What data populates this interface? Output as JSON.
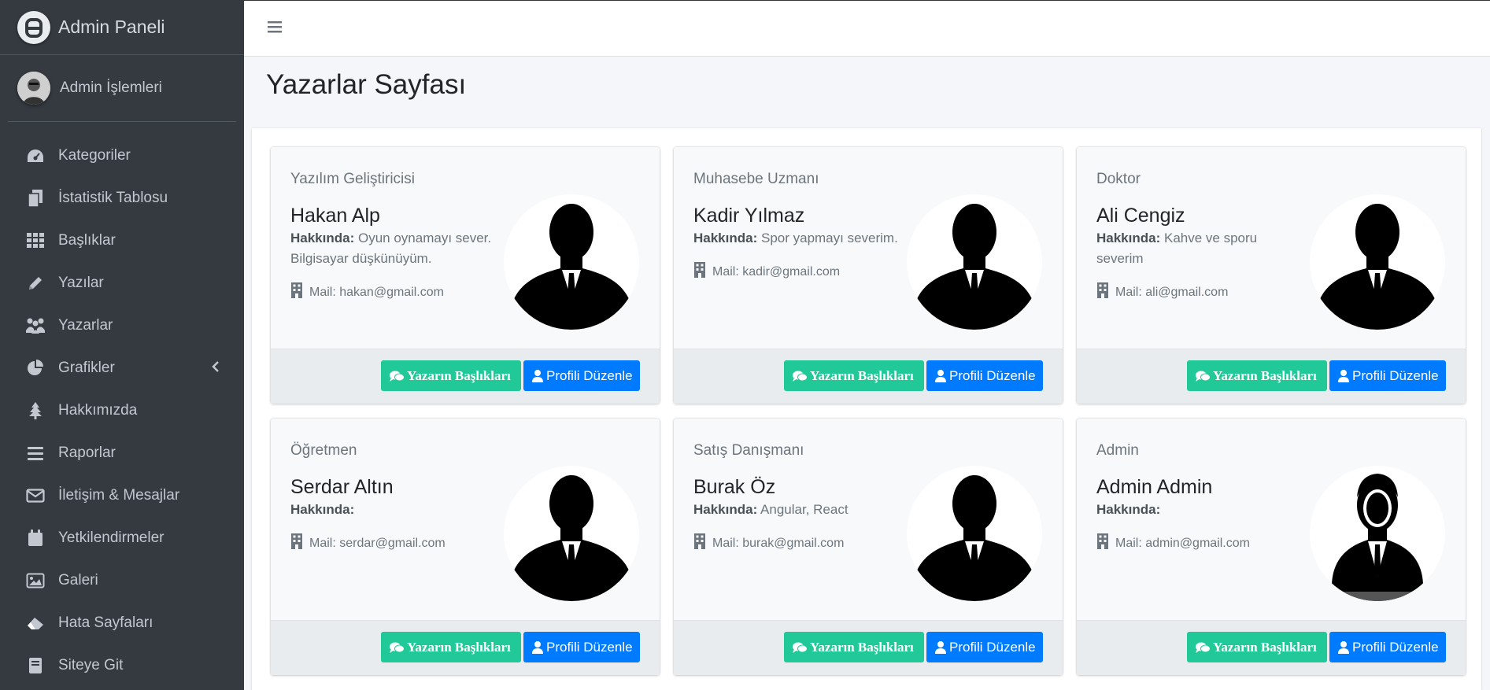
{
  "brand": {
    "title": "Admin Paneli"
  },
  "user": {
    "name": "Admin İşlemleri"
  },
  "sidebar": {
    "items": [
      {
        "label": "Kategoriler",
        "icon": "tachometer-icon"
      },
      {
        "label": "İstatistik Tablosu",
        "icon": "copy-icon"
      },
      {
        "label": "Başlıklar",
        "icon": "grid-icon"
      },
      {
        "label": "Yazılar",
        "icon": "pencil-icon"
      },
      {
        "label": "Yazarlar",
        "icon": "users-icon"
      },
      {
        "label": "Grafikler",
        "icon": "pie-chart-icon"
      },
      {
        "label": "Hakkımızda",
        "icon": "tree-icon"
      },
      {
        "label": "Raporlar",
        "icon": "bars-icon"
      },
      {
        "label": "İletişim & Mesajlar",
        "icon": "envelope-icon"
      },
      {
        "label": "Yetkilendirmeler",
        "icon": "calendar-icon"
      },
      {
        "label": "Galeri",
        "icon": "image-icon"
      },
      {
        "label": "Hata Sayfaları",
        "icon": "eraser-icon"
      },
      {
        "label": "Siteye Git",
        "icon": "book-icon"
      }
    ]
  },
  "page": {
    "title": "Yazarlar Sayfası"
  },
  "labels": {
    "about": "Hakkında:",
    "mail_prefix": "Mail: ",
    "titles_button": "Yazarın Başlıkları",
    "edit_button": "Profili Düzenle"
  },
  "authors": [
    {
      "role": "Yazılım Geliştiricisi",
      "name": "Hakan Alp",
      "about": "Oyun oynamayı sever. Bilgisayar düşkünüyüm.",
      "mail": "hakan@gmail.com"
    },
    {
      "role": "Muhasebe Uzmanı",
      "name": "Kadir Yılmaz",
      "about": "Spor yapmayı severim.",
      "mail": "kadir@gmail.com"
    },
    {
      "role": "Doktor",
      "name": "Ali Cengiz",
      "about": "Kahve ve sporu severim",
      "mail": "ali@gmail.com"
    },
    {
      "role": "Öğretmen",
      "name": "Serdar Altın",
      "about": "",
      "mail": "serdar@gmail.com"
    },
    {
      "role": "Satış Danışmanı",
      "name": "Burak Öz",
      "about": "Angular, React",
      "mail": "burak@gmail.com"
    },
    {
      "role": "Admin",
      "name": "Admin Admin",
      "about": "",
      "mail": "admin@gmail.com"
    }
  ],
  "colors": {
    "sidebar": "#343a40",
    "green": "#20c997",
    "blue": "#007bff"
  }
}
